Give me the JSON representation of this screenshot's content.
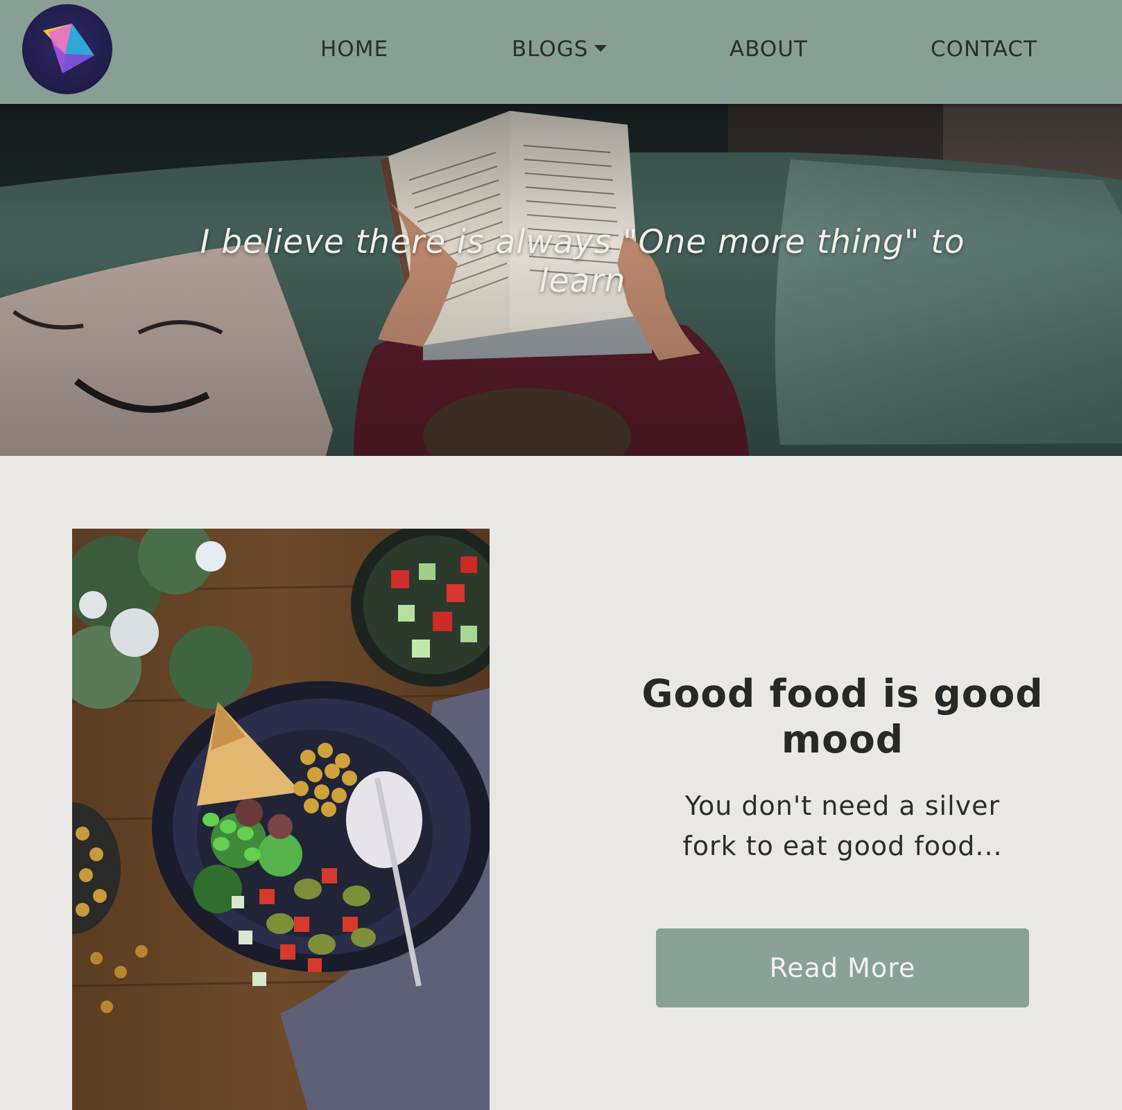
{
  "navbar": {
    "logo_icon": "bird-logo-icon",
    "items": [
      {
        "label": "HOME"
      },
      {
        "label": "BLOGS",
        "icon": "caret-down-icon"
      },
      {
        "label": "ABOUT"
      },
      {
        "label": "CONTACT"
      }
    ]
  },
  "hero": {
    "quote": "I believe there is always \"One more thing\" to learn",
    "image": "woman-reading-book-on-couch"
  },
  "feature": {
    "image": "food-bowl-on-wooden-table",
    "title": "Good food is good mood",
    "text": "You don't need a silver fork to eat good food...",
    "button_label": "Read More"
  },
  "colors": {
    "navbar_bg": "#889f95",
    "page_bg": "#e9e8e4",
    "button_bg": "#8aa196",
    "logo_bg": "#201c4a"
  }
}
